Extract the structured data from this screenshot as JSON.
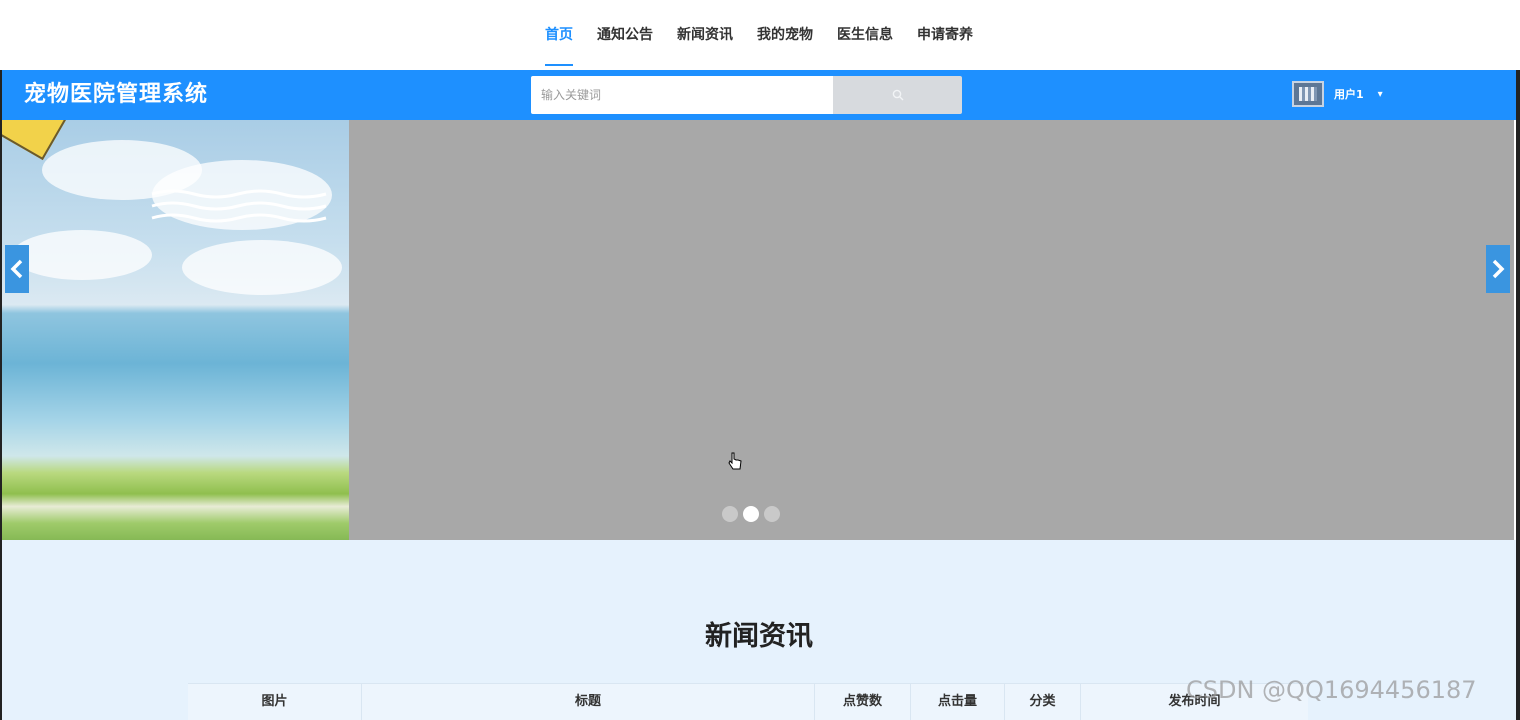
{
  "nav": {
    "items": [
      {
        "label": "首页",
        "active": true
      },
      {
        "label": "通知公告",
        "active": false
      },
      {
        "label": "新闻资讯",
        "active": false
      },
      {
        "label": "我的宠物",
        "active": false
      },
      {
        "label": "医生信息",
        "active": false
      },
      {
        "label": "申请寄养",
        "active": false
      }
    ]
  },
  "header": {
    "logo": "宠物医院管理系统",
    "search": {
      "placeholder": "输入关键词",
      "value": ""
    },
    "user": {
      "name": "用户1",
      "caret": "▾"
    }
  },
  "banner": {
    "slide_count": 3,
    "active_slide": 2,
    "prev_icon": "chevron-left-icon",
    "next_icon": "chevron-right-icon"
  },
  "news": {
    "title": "新闻资讯",
    "columns": [
      "图片",
      "标题",
      "点赞数",
      "点击量",
      "分类",
      "发布时间"
    ]
  },
  "watermark": "CSDN @QQ1694456187",
  "colors": {
    "accent": "#1e90ff",
    "banner_bg": "#a8a8a8",
    "section_bg": "#e6f2fd"
  }
}
